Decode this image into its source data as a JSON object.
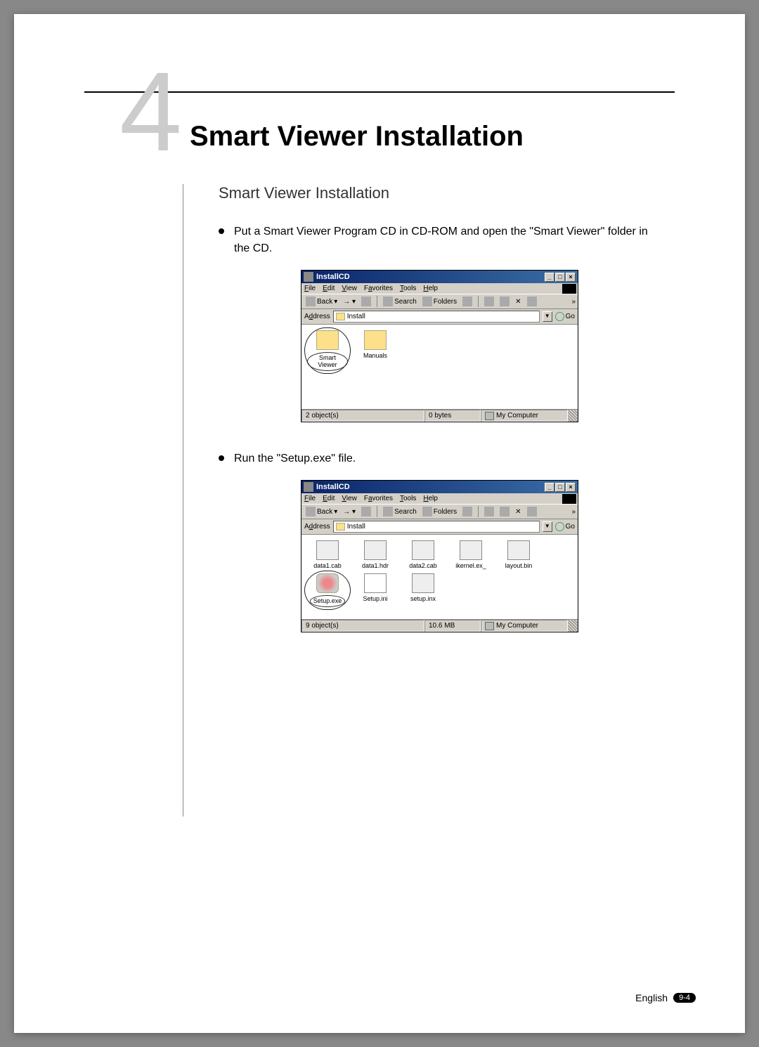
{
  "chapter": {
    "number": "4",
    "title": "Smart Viewer Installation"
  },
  "section_title": "Smart Viewer Installation",
  "bullets": [
    "Put a Smart Viewer Program CD in CD-ROM and open the \"Smart Viewer\" folder in the CD.",
    "Run the \"Setup.exe\" file."
  ],
  "explorer_common": {
    "title": "InstallCD",
    "menus": {
      "file": "File",
      "edit": "Edit",
      "view": "View",
      "favorites": "Favorites",
      "tools": "Tools",
      "help": "Help"
    },
    "toolbar": {
      "back": "Back",
      "search": "Search",
      "folders": "Folders",
      "chevron": "»"
    },
    "address_label": "Address",
    "address_value": "Install",
    "addr_drop": "▼",
    "go": "Go",
    "winbtns": {
      "min": "_",
      "max": "□",
      "close": "×"
    },
    "status_location": "My Computer"
  },
  "window1": {
    "files": [
      {
        "label": "Smart Viewer",
        "circled": true,
        "icon": "folder"
      },
      {
        "label": "Manuals",
        "circled": false,
        "icon": "folder"
      }
    ],
    "status_objects": "2 object(s)",
    "status_size": "0 bytes"
  },
  "window2": {
    "files": [
      {
        "label": "data1.cab",
        "icon": "generic"
      },
      {
        "label": "data1.hdr",
        "icon": "generic"
      },
      {
        "label": "data2.cab",
        "icon": "generic"
      },
      {
        "label": "ikernel.ex_",
        "icon": "generic"
      },
      {
        "label": "layout.bin",
        "icon": "generic"
      },
      {
        "label": "Setup.exe",
        "icon": "exe",
        "circled": true
      },
      {
        "label": "Setup.ini",
        "icon": "ini"
      },
      {
        "label": "setup.inx",
        "icon": "generic"
      }
    ],
    "status_objects": "9 object(s)",
    "status_size": "10.6 MB"
  },
  "footer": {
    "lang": "English",
    "page": "9-4"
  }
}
